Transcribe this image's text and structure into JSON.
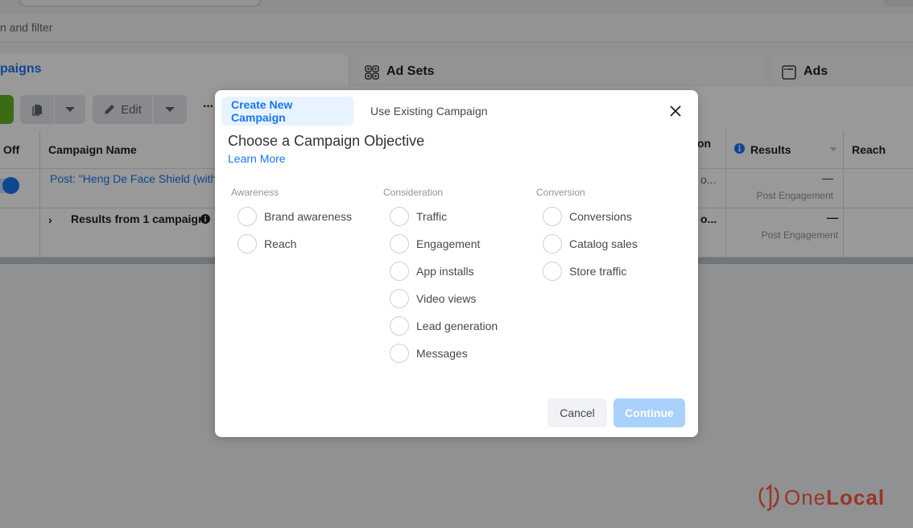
{
  "background": {
    "search_filter_text": "n and filter",
    "tabs": {
      "campaigns": "paigns",
      "ad_sets": "Ad Sets",
      "ads": "Ads"
    },
    "toolbar": {
      "edit_label": "Edit",
      "more_label": "···"
    },
    "table": {
      "headers": {
        "off": "Off",
        "campaign_name": "Campaign Name",
        "partial": "on",
        "results": "Results",
        "reach": "Reach"
      },
      "rows": [
        {
          "campaign_name": "Post: \"Heng De Face Shield (with",
          "partial": "o...",
          "results_value": "—",
          "results_type": "Post Engagement"
        }
      ],
      "summary": {
        "label": "Results from 1 campaign",
        "partial": "o...",
        "results_value": "—",
        "results_type": "Post Engagement"
      }
    },
    "watermark": {
      "part1": "One",
      "part2": "Local",
      "color": "#ff5a40"
    }
  },
  "modal": {
    "tabs": [
      {
        "label": "Create New Campaign",
        "active": true
      },
      {
        "label": "Use Existing Campaign",
        "active": false
      }
    ],
    "title": "Choose a Campaign Objective",
    "learn_more": "Learn More",
    "columns": [
      {
        "title": "Awareness",
        "options": [
          "Brand awareness",
          "Reach"
        ]
      },
      {
        "title": "Consideration",
        "options": [
          "Traffic",
          "Engagement",
          "App installs",
          "Video views",
          "Lead generation",
          "Messages"
        ]
      },
      {
        "title": "Conversion",
        "options": [
          "Conversions",
          "Catalog sales",
          "Store traffic"
        ]
      }
    ],
    "cancel_label": "Cancel",
    "continue_label": "Continue",
    "accent_color": "#1877f2"
  }
}
